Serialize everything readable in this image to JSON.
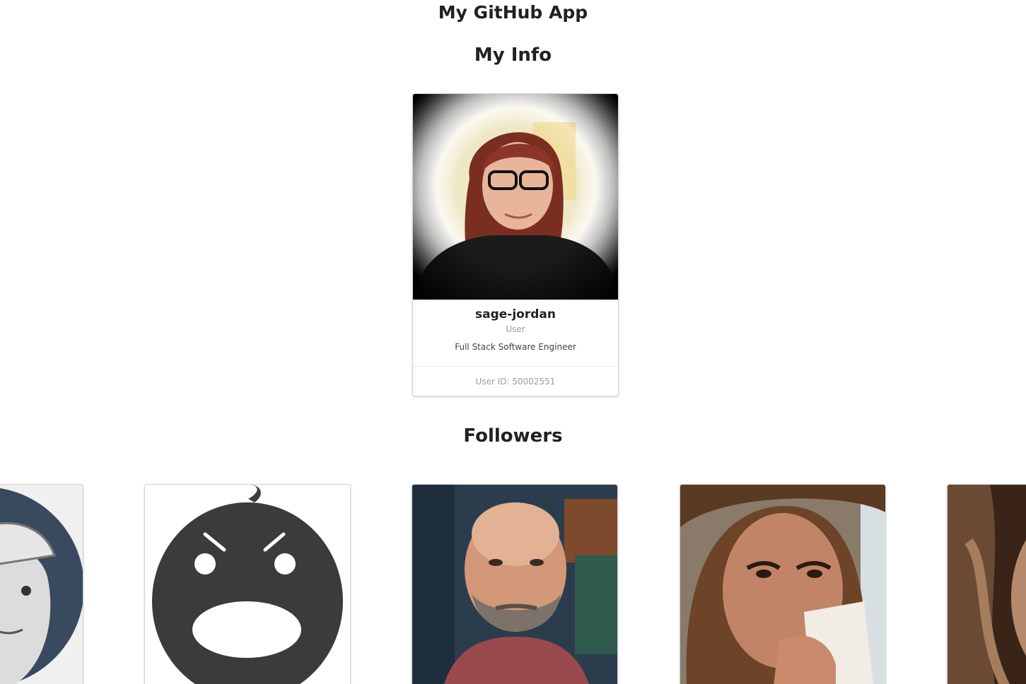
{
  "app": {
    "title": "My GitHub App"
  },
  "my_info": {
    "section_title": "My Info",
    "card": {
      "username": "sage-jordan",
      "type": "User",
      "bio": "Full Stack Software Engineer",
      "user_id_label": "User ID: 50002551"
    }
  },
  "followers": {
    "section_title": "Followers",
    "items": [
      {
        "avatar": "illustrated-man-in-cap-avatar"
      },
      {
        "avatar": "angry-dark-blob-avatar"
      },
      {
        "avatar": "bald-bearded-man-photo-avatar"
      },
      {
        "avatar": "woman-drinking-from-mug-photo-avatar"
      },
      {
        "avatar": "long-haired-person-photo-avatar"
      }
    ]
  },
  "colors": {
    "text": "#212121",
    "meta": "#9b9b9b",
    "card_border": "#d4d4d5"
  }
}
